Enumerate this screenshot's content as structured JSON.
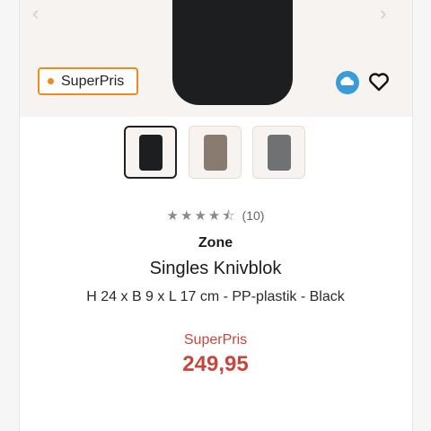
{
  "gallery": {
    "prev_icon": "chevron-left-icon",
    "next_icon": "chevron-right-icon",
    "badge_label": "SuperPris",
    "eco_icon": "eco-cloud-icon",
    "favorite_icon": "heart-outline-icon"
  },
  "thumbnails": [
    {
      "color": "#1c1e1f",
      "selected": true
    },
    {
      "color": "#8a7b71",
      "selected": false
    },
    {
      "color": "#6f7173",
      "selected": false
    }
  ],
  "product": {
    "rating_stars": "★★★★⯪",
    "rating_count": "(10)",
    "brand": "Zone",
    "title": "Singles Knivblok",
    "specs": "H 24 x B 9 x L 17 cm - PP-plastik - Black",
    "price_label": "SuperPris",
    "price": "249,95"
  },
  "colors": {
    "accent_orange": "#f08a1a",
    "price_red": "#c9463d"
  }
}
